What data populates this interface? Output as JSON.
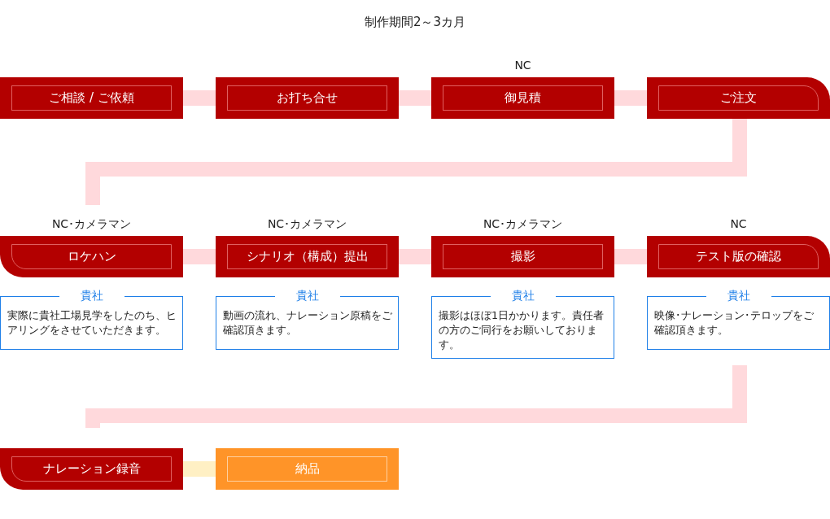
{
  "title": "制作期間2～3カ月",
  "rows": [
    {
      "steps": [
        {
          "label": "ご相談 / ご依頼",
          "kind": "step"
        },
        {
          "label": "お打ち合せ",
          "kind": "step"
        },
        {
          "role": "NC",
          "label": "御見積",
          "kind": "step"
        },
        {
          "label": "ご注文",
          "kind": "step"
        }
      ]
    },
    {
      "steps": [
        {
          "role": "NC･カメラマン",
          "label": "ロケハン",
          "kind": "step",
          "note": {
            "party": "貴社",
            "text": "実際に貴社工場見学をしたのち、ヒアリングをさせていただきます。"
          }
        },
        {
          "role": "NC･カメラマン",
          "label": "シナリオ（構成）提出",
          "kind": "step",
          "note": {
            "party": "貴社",
            "text": "動画の流れ、ナレーション原稿をご確認頂きます。"
          }
        },
        {
          "role": "NC･カメラマン",
          "label": "撮影",
          "kind": "step",
          "note": {
            "party": "貴社",
            "text": "撮影はほぼ1日かかります。責任者の方のご同行をお願いしております。"
          }
        },
        {
          "role": "NC",
          "label": "テスト版の確認",
          "kind": "step",
          "note": {
            "party": "貴社",
            "text": "映像･ナレーション･テロップをご確認頂きます。"
          }
        }
      ]
    },
    {
      "steps": [
        {
          "label": "ナレーション録音",
          "kind": "step"
        },
        {
          "label": "納品",
          "kind": "delivery"
        }
      ]
    }
  ]
}
